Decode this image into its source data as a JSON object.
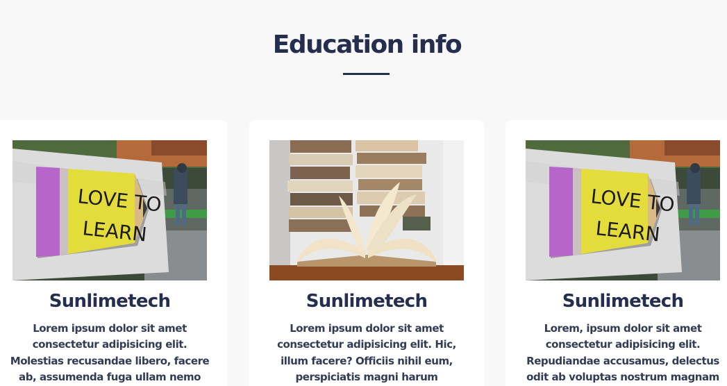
{
  "section": {
    "title": "Education info"
  },
  "cards": [
    {
      "image": "love-to-learn-pencil-sign-photo",
      "sign_text": "LOVE TO LEARN",
      "title": "Sunlimetech",
      "text": "Lorem ipsum dolor sit amet consectetur adipisicing elit. Molestias recusandae libero, facere ab, assumenda fuga ullam nemo"
    },
    {
      "image": "open-book-on-stacked-books-photo",
      "title": "Sunlimetech",
      "text": "Lorem ipsum dolor sit amet consectetur adipisicing elit. Hic, illum facere? Officiis nihil eum, perspiciatis magni harum"
    },
    {
      "image": "love-to-learn-pencil-sign-photo",
      "sign_text": "LOVE TO LEARN",
      "title": "Sunlimetech",
      "text": "Lorem, ipsum dolor sit amet consectetur adipisicing elit. Repudiandae accusamus, delectus odit ab voluptas nostrum magnam"
    }
  ],
  "colors": {
    "heading": "#252f4d",
    "body_text": "#343c54",
    "page_background": "#f8f8f9",
    "card_background": "#ffffff"
  }
}
